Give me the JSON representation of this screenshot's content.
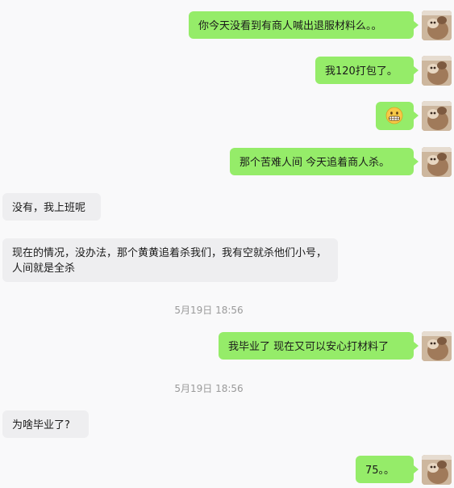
{
  "messages": [
    {
      "side": "out",
      "text": "你今天没看到有商人喊出退服材料么。。"
    },
    {
      "side": "out",
      "text": "我120打包了。"
    },
    {
      "side": "out",
      "emoji": "grimacing-face-icon"
    },
    {
      "side": "out",
      "text": "那个苦难人间 今天追着商人杀。"
    },
    {
      "side": "in",
      "text": "没有，我上班呢"
    },
    {
      "side": "in",
      "text": "现在的情况，没办法，那个黄黄追着杀我们，我有空就杀他们小号，人间就是全杀"
    },
    {
      "type": "time",
      "text": "5月19日 18:56"
    },
    {
      "side": "out",
      "text": "我毕业了 现在又可以安心打材料了"
    },
    {
      "type": "time",
      "text": "5月19日 18:56"
    },
    {
      "side": "in",
      "text": "为啥毕业了?"
    },
    {
      "side": "out",
      "text": "75。。"
    }
  ],
  "colors": {
    "outgoing_bubble": "#95ec69",
    "incoming_bubble": "#eeeef0",
    "background": "#f9f9fa",
    "timestamp_text": "#9a9a9a"
  }
}
